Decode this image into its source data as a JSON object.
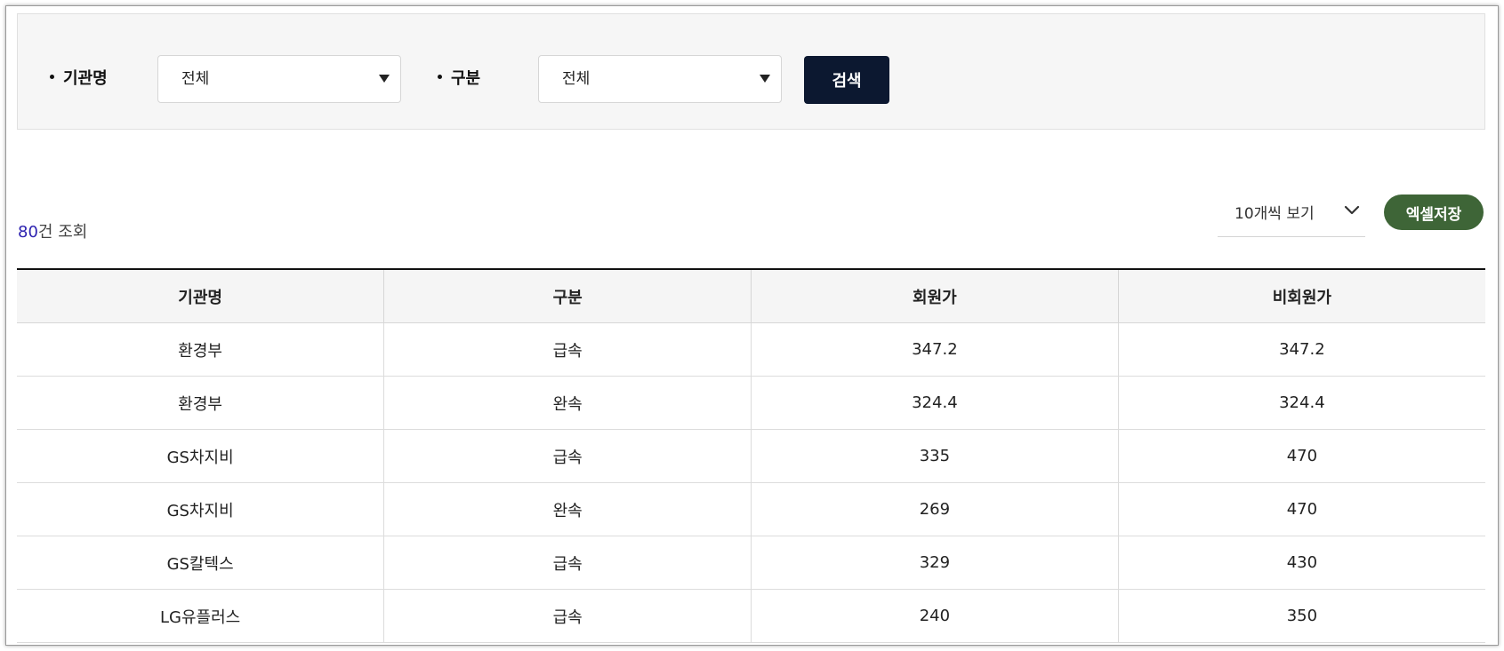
{
  "filters": {
    "agency_label": "기관명",
    "agency_value": "전체",
    "type_label": "구분",
    "type_value": "전체",
    "search_label": "검색"
  },
  "results": {
    "count": "80",
    "count_suffix": "건 조회",
    "page_size_label": "10개씩 보기",
    "excel_label": "엑셀저장"
  },
  "table": {
    "columns": [
      "기관명",
      "구분",
      "회원가",
      "비회원가"
    ],
    "rows": [
      [
        "환경부",
        "급속",
        "347.2",
        "347.2"
      ],
      [
        "환경부",
        "완속",
        "324.4",
        "324.4"
      ],
      [
        "GS차지비",
        "급속",
        "335",
        "470"
      ],
      [
        "GS차지비",
        "완속",
        "269",
        "470"
      ],
      [
        "GS칼텍스",
        "급속",
        "329",
        "430"
      ],
      [
        "LG유플러스",
        "급속",
        "240",
        "350"
      ]
    ]
  },
  "icons": {
    "select_caret": "caret-down-icon",
    "page_size_chevron": "chevron-down-icon"
  },
  "colors": {
    "search_button": "#0c1830",
    "excel_button": "#3e6537",
    "count_number": "#2d22b0",
    "panel_background": "#f6f6f6"
  }
}
